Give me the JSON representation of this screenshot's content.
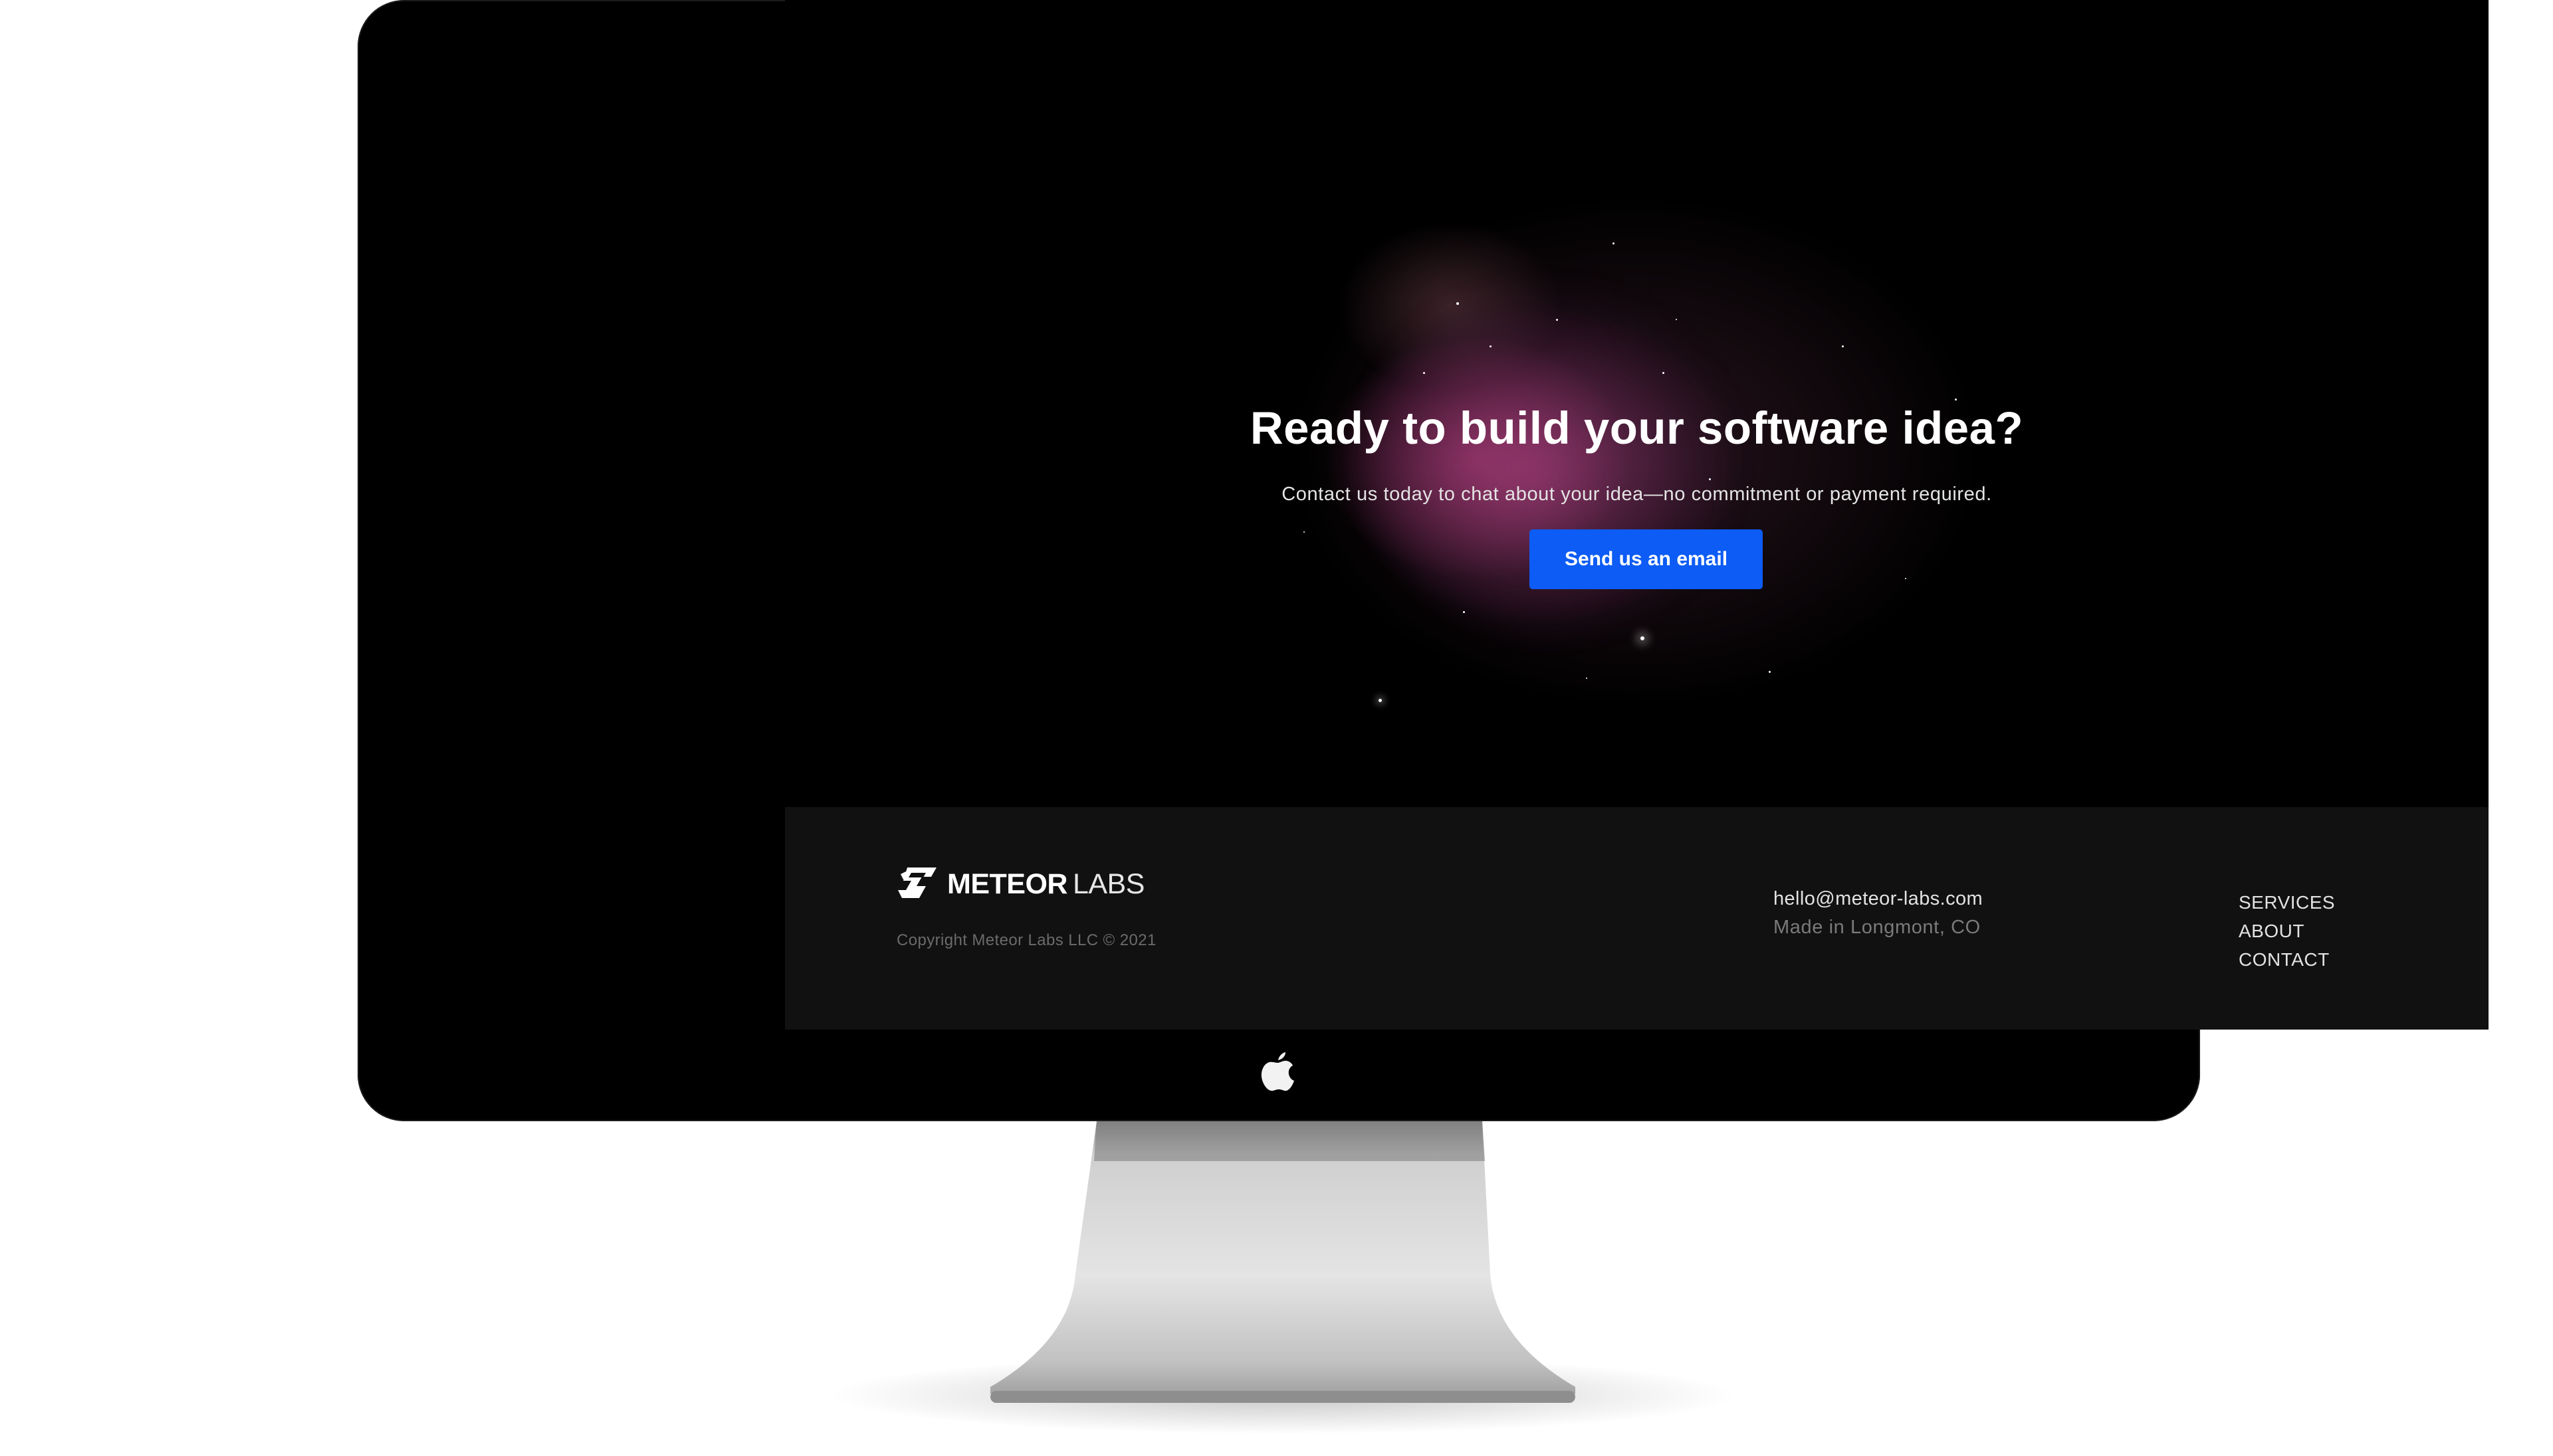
{
  "hero": {
    "title": "Ready to build your software idea?",
    "subtitle": "Contact us today to chat about your idea—no commitment or payment required.",
    "cta_label": "Send us an email"
  },
  "footer": {
    "brand_primary": "METEOR",
    "brand_secondary": "LABS",
    "copyright": "Copyright Meteor Labs LLC © 2021",
    "email": "hello@meteor-labs.com",
    "location": "Made in Longmont, CO",
    "nav": {
      "services": "SERVICES",
      "about": "ABOUT",
      "contact": "CONTACT"
    }
  },
  "device": {
    "logo_icon": "apple-icon"
  },
  "colors": {
    "cta_background": "#0c5cf5",
    "footer_background": "#111111",
    "page_background": "#000000"
  }
}
